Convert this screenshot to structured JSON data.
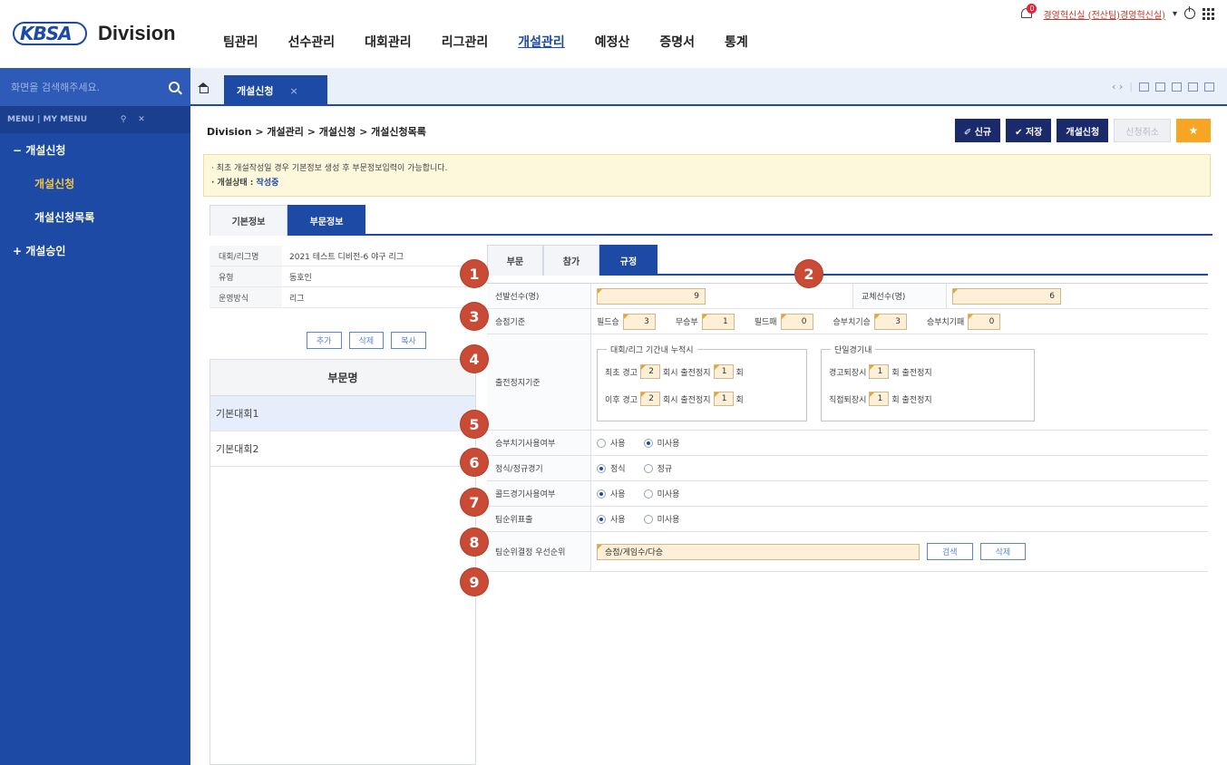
{
  "header": {
    "logo_text": "KBSA",
    "division_label": "Division",
    "nav": [
      "팀관리",
      "선수관리",
      "대회관리",
      "리그관리",
      "개설관리",
      "예정산",
      "증명서",
      "통계"
    ],
    "active_nav": "개설관리",
    "notification_count": "0",
    "user_label": "경영혁신실 (전산팀)경영혁신실)",
    "icons": [
      "bell-icon",
      "power-icon",
      "apps-grid-icon"
    ]
  },
  "sidebar": {
    "search_placeholder": "화면을 검색해주세요.",
    "menu_tabs": "MENU | MY MENU",
    "groups": [
      {
        "label": "− 개설신청",
        "items": [
          "개설신청",
          "개설신청목록"
        ],
        "active_item": "개설신청"
      },
      {
        "label": "+ 개설승인",
        "items": []
      }
    ]
  },
  "tabbar": {
    "active_tab": "개설신청",
    "close_glyph": "×",
    "nav_glyphs": "‹ ›"
  },
  "breadcrumb": "Division > 개설관리 > 개설신청 > 개설신청목록",
  "actions": {
    "new": "✐ 신규",
    "save": "✔ 저장",
    "apply": "개설신청",
    "cancel": "신청취소",
    "favorite": "★"
  },
  "notice": {
    "line1": "· 최초 개설작성일 경우 기본정보 생성 후 부문정보입력이 가능합니다.",
    "status_label": "· 개설상태 : ",
    "status_value": "작성중"
  },
  "section_tabs": [
    "기본정보",
    "부문정보"
  ],
  "active_section_tab": "부문정보",
  "info": {
    "rows": [
      {
        "label": "대회/리그명",
        "value": "2021 테스트 디비전-6 야구 리그"
      },
      {
        "label": "유형",
        "value": "동호인"
      },
      {
        "label": "운영방식",
        "value": "리그"
      }
    ],
    "buttons": [
      "추가",
      "삭제",
      "복사"
    ]
  },
  "division_list": {
    "header": "부문명",
    "rows": [
      "기본대회1",
      "기본대회2"
    ],
    "selected": "기본대회1"
  },
  "inner_tabs": [
    "부문",
    "참가",
    "규정"
  ],
  "active_inner_tab": "규정",
  "rules": {
    "starters_label": "선발선수(명)",
    "starters_value": "9",
    "subs_label": "교체선수(명)",
    "subs_value": "6",
    "points_label": "승점기준",
    "points": [
      {
        "label": "필드승",
        "value": "3"
      },
      {
        "label": "무승부",
        "value": "1"
      },
      {
        "label": "필드패",
        "value": "0"
      },
      {
        "label": "승부치기승",
        "value": "3"
      },
      {
        "label": "승부치기패",
        "value": "0"
      }
    ],
    "suspension_label": "출전정지기준",
    "cumulative_legend": "대회/리그 기간내 누적시",
    "first_warning": "최초 경고",
    "first_warning_val": "2",
    "first_suspend_val": "1",
    "later_warning": "이후 경고",
    "later_warning_val": "2",
    "later_suspend_val": "1",
    "suspend_text": "회시 출전정지",
    "game_unit": "회",
    "single_legend": "단일경기내",
    "warn_exit": "경고퇴장시",
    "warn_exit_val": "1",
    "direct_exit": "직접퇴장시",
    "direct_exit_val": "1",
    "single_suffix": "회 출전정지",
    "tiebreak_use_label": "승부치기사용여부",
    "tiebreak_use_options": [
      "사용",
      "미사용"
    ],
    "tiebreak_use_selected": "미사용",
    "official_label": "정식/정규경기",
    "official_options": [
      "정식",
      "정규"
    ],
    "official_selected": "정식",
    "cold_label": "콜드경기사용여부",
    "cold_options": [
      "사용",
      "미사용"
    ],
    "cold_selected": "사용",
    "rank_out_label": "팀순위표출",
    "rank_out_options": [
      "사용",
      "미사용"
    ],
    "rank_out_selected": "사용",
    "priority_label": "팀순위결정 우선순위",
    "priority_value": "승점/게임수/다승",
    "priority_buttons": [
      "검색",
      "삭제"
    ]
  },
  "markers": [
    "1",
    "2",
    "3",
    "4",
    "5",
    "6",
    "7",
    "8",
    "9"
  ],
  "colors": {
    "primary": "#1d4aa5",
    "dark_button": "#1a2a6b",
    "accent": "#f6a623",
    "marker": "#c94a35",
    "notice_bg": "#fdf8dc"
  }
}
